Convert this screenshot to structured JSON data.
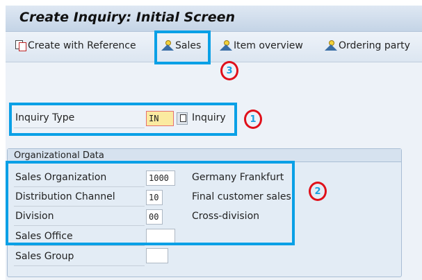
{
  "title": "Create Inquiry: Initial Screen",
  "toolbar": {
    "create_with_reference": "Create with Reference",
    "sales": "Sales",
    "item_overview": "Item overview",
    "ordering_party": "Ordering party"
  },
  "inquiry": {
    "label": "Inquiry Type",
    "value": "IN",
    "description": "Inquiry"
  },
  "org_data": {
    "title": "Organizational Data",
    "rows": [
      {
        "label": "Sales Organization",
        "value": "1000",
        "description": "Germany Frankfurt"
      },
      {
        "label": "Distribution Channel",
        "value": "10",
        "description": "Final customer sales"
      },
      {
        "label": "Division",
        "value": "00",
        "description": "Cross-division"
      },
      {
        "label": "Sales Office",
        "value": "",
        "description": ""
      },
      {
        "label": "Sales Group",
        "value": "",
        "description": ""
      }
    ]
  },
  "annotations": {
    "one": "1",
    "two": "2",
    "three": "3"
  },
  "colors": {
    "highlight": "#0aa0e6",
    "marker": "#e0101a",
    "required_field": "#fbeaa0"
  }
}
